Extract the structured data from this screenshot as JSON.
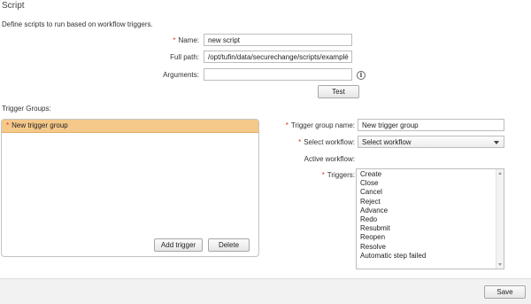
{
  "header": {
    "title": "Script",
    "description": "Define scripts to run based on workflow triggers."
  },
  "form": {
    "required_marker": "*",
    "name_label": "Name:",
    "name_value": "new script",
    "full_path_label": "Full path:",
    "full_path_value": "/opt/tufin/data/securechange/scripts/examplé",
    "arguments_label": "Arguments:",
    "arguments_value": "",
    "info_icon": "info-icon",
    "test_label": "Test"
  },
  "trigger_groups": {
    "section_label": "Trigger Groups:",
    "items": [
      {
        "label": "New trigger group",
        "required": true,
        "selected": true
      }
    ],
    "add_trigger_label": "Add trigger",
    "delete_label": "Delete"
  },
  "trigger_detail": {
    "group_name_label": "Trigger group name:",
    "group_name_value": "New trigger group",
    "select_workflow_label": "Select workflow:",
    "select_workflow_value": "Select workflow",
    "active_workflow_label": "Active workflow:",
    "triggers_label": "Triggers:",
    "triggers": [
      "Create",
      "Close",
      "Cancel",
      "Reject",
      "Advance",
      "Redo",
      "Resubmit",
      "Reopen",
      "Resolve",
      "Automatic step failed"
    ]
  },
  "footer": {
    "save_label": "Save"
  },
  "colors": {
    "required": "#d9362b",
    "selected_row": "#f5c98a"
  }
}
